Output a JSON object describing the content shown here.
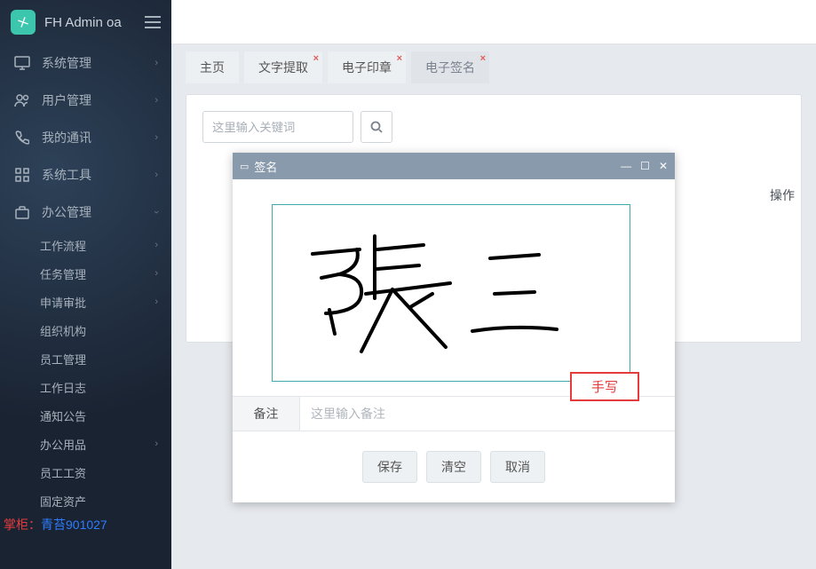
{
  "app": {
    "title": "FH Admin oa"
  },
  "sidebar": {
    "items": [
      {
        "label": "系统管理"
      },
      {
        "label": "用户管理"
      },
      {
        "label": "我的通讯"
      },
      {
        "label": "系统工具"
      },
      {
        "label": "办公管理"
      }
    ],
    "subItems": [
      {
        "label": "工作流程"
      },
      {
        "label": "任务管理"
      },
      {
        "label": "申请审批"
      },
      {
        "label": "组织机构"
      },
      {
        "label": "员工管理"
      },
      {
        "label": "工作日志"
      },
      {
        "label": "通知公告"
      },
      {
        "label": "办公用品"
      },
      {
        "label": "员工工资"
      },
      {
        "label": "固定资产"
      }
    ],
    "footer": {
      "prefix": "掌柜：",
      "value": "青苔901027"
    }
  },
  "tabs": [
    {
      "label": "主页",
      "closable": false
    },
    {
      "label": "文字提取",
      "closable": true
    },
    {
      "label": "电子印章",
      "closable": true
    },
    {
      "label": "电子签名",
      "closable": true,
      "active": true
    }
  ],
  "search": {
    "placeholder": "这里输入关键词"
  },
  "opsLabel": "操作",
  "dialog": {
    "title": "签名",
    "handLabel": "手写",
    "remarkLabel": "备注",
    "remarkPlaceholder": "这里输入备注",
    "buttons": {
      "save": "保存",
      "clear": "清空",
      "cancel": "取消"
    }
  }
}
